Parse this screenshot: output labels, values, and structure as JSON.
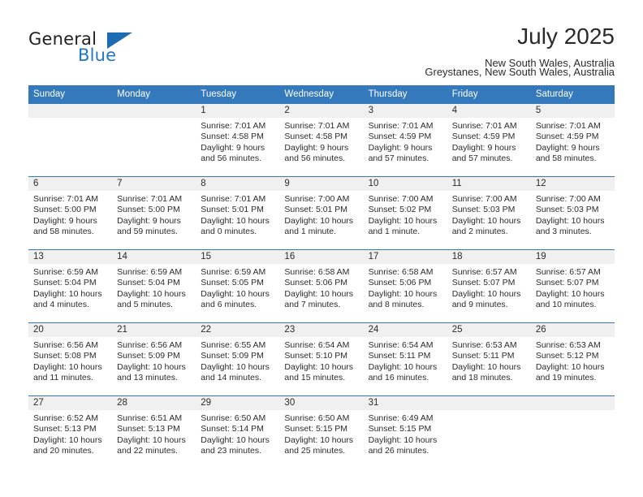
{
  "brand": {
    "name_part1": "General",
    "name_part2": "Blue",
    "triangle_color": "#1b6cb3",
    "blue_color": "#1f78c1"
  },
  "header": {
    "month_title": "July 2025",
    "region_line": "New South Wales, Australia",
    "location_line": "Greystanes, New South Wales, Australia"
  },
  "theme": {
    "header_bg": "#3479bb",
    "daynum_bg": "#f0f0f0",
    "text": "#2b2b2b"
  },
  "calendar": {
    "weekday_headers": [
      "Sunday",
      "Monday",
      "Tuesday",
      "Wednesday",
      "Thursday",
      "Friday",
      "Saturday"
    ],
    "weeks": [
      [
        {
          "day": "",
          "empty": true,
          "sunrise": "",
          "sunset": "",
          "daylight_line1": "",
          "daylight_line2": ""
        },
        {
          "day": "",
          "empty": true,
          "sunrise": "",
          "sunset": "",
          "daylight_line1": "",
          "daylight_line2": ""
        },
        {
          "day": "1",
          "sunrise": "Sunrise: 7:01 AM",
          "sunset": "Sunset: 4:58 PM",
          "daylight_line1": "Daylight: 9 hours",
          "daylight_line2": "and 56 minutes."
        },
        {
          "day": "2",
          "sunrise": "Sunrise: 7:01 AM",
          "sunset": "Sunset: 4:58 PM",
          "daylight_line1": "Daylight: 9 hours",
          "daylight_line2": "and 56 minutes."
        },
        {
          "day": "3",
          "sunrise": "Sunrise: 7:01 AM",
          "sunset": "Sunset: 4:59 PM",
          "daylight_line1": "Daylight: 9 hours",
          "daylight_line2": "and 57 minutes."
        },
        {
          "day": "4",
          "sunrise": "Sunrise: 7:01 AM",
          "sunset": "Sunset: 4:59 PM",
          "daylight_line1": "Daylight: 9 hours",
          "daylight_line2": "and 57 minutes."
        },
        {
          "day": "5",
          "sunrise": "Sunrise: 7:01 AM",
          "sunset": "Sunset: 4:59 PM",
          "daylight_line1": "Daylight: 9 hours",
          "daylight_line2": "and 58 minutes."
        }
      ],
      [
        {
          "day": "6",
          "sunrise": "Sunrise: 7:01 AM",
          "sunset": "Sunset: 5:00 PM",
          "daylight_line1": "Daylight: 9 hours",
          "daylight_line2": "and 58 minutes."
        },
        {
          "day": "7",
          "sunrise": "Sunrise: 7:01 AM",
          "sunset": "Sunset: 5:00 PM",
          "daylight_line1": "Daylight: 9 hours",
          "daylight_line2": "and 59 minutes."
        },
        {
          "day": "8",
          "sunrise": "Sunrise: 7:01 AM",
          "sunset": "Sunset: 5:01 PM",
          "daylight_line1": "Daylight: 10 hours",
          "daylight_line2": "and 0 minutes."
        },
        {
          "day": "9",
          "sunrise": "Sunrise: 7:00 AM",
          "sunset": "Sunset: 5:01 PM",
          "daylight_line1": "Daylight: 10 hours",
          "daylight_line2": "and 1 minute."
        },
        {
          "day": "10",
          "sunrise": "Sunrise: 7:00 AM",
          "sunset": "Sunset: 5:02 PM",
          "daylight_line1": "Daylight: 10 hours",
          "daylight_line2": "and 1 minute."
        },
        {
          "day": "11",
          "sunrise": "Sunrise: 7:00 AM",
          "sunset": "Sunset: 5:03 PM",
          "daylight_line1": "Daylight: 10 hours",
          "daylight_line2": "and 2 minutes."
        },
        {
          "day": "12",
          "sunrise": "Sunrise: 7:00 AM",
          "sunset": "Sunset: 5:03 PM",
          "daylight_line1": "Daylight: 10 hours",
          "daylight_line2": "and 3 minutes."
        }
      ],
      [
        {
          "day": "13",
          "sunrise": "Sunrise: 6:59 AM",
          "sunset": "Sunset: 5:04 PM",
          "daylight_line1": "Daylight: 10 hours",
          "daylight_line2": "and 4 minutes."
        },
        {
          "day": "14",
          "sunrise": "Sunrise: 6:59 AM",
          "sunset": "Sunset: 5:04 PM",
          "daylight_line1": "Daylight: 10 hours",
          "daylight_line2": "and 5 minutes."
        },
        {
          "day": "15",
          "sunrise": "Sunrise: 6:59 AM",
          "sunset": "Sunset: 5:05 PM",
          "daylight_line1": "Daylight: 10 hours",
          "daylight_line2": "and 6 minutes."
        },
        {
          "day": "16",
          "sunrise": "Sunrise: 6:58 AM",
          "sunset": "Sunset: 5:06 PM",
          "daylight_line1": "Daylight: 10 hours",
          "daylight_line2": "and 7 minutes."
        },
        {
          "day": "17",
          "sunrise": "Sunrise: 6:58 AM",
          "sunset": "Sunset: 5:06 PM",
          "daylight_line1": "Daylight: 10 hours",
          "daylight_line2": "and 8 minutes."
        },
        {
          "day": "18",
          "sunrise": "Sunrise: 6:57 AM",
          "sunset": "Sunset: 5:07 PM",
          "daylight_line1": "Daylight: 10 hours",
          "daylight_line2": "and 9 minutes."
        },
        {
          "day": "19",
          "sunrise": "Sunrise: 6:57 AM",
          "sunset": "Sunset: 5:07 PM",
          "daylight_line1": "Daylight: 10 hours",
          "daylight_line2": "and 10 minutes."
        }
      ],
      [
        {
          "day": "20",
          "sunrise": "Sunrise: 6:56 AM",
          "sunset": "Sunset: 5:08 PM",
          "daylight_line1": "Daylight: 10 hours",
          "daylight_line2": "and 11 minutes."
        },
        {
          "day": "21",
          "sunrise": "Sunrise: 6:56 AM",
          "sunset": "Sunset: 5:09 PM",
          "daylight_line1": "Daylight: 10 hours",
          "daylight_line2": "and 13 minutes."
        },
        {
          "day": "22",
          "sunrise": "Sunrise: 6:55 AM",
          "sunset": "Sunset: 5:09 PM",
          "daylight_line1": "Daylight: 10 hours",
          "daylight_line2": "and 14 minutes."
        },
        {
          "day": "23",
          "sunrise": "Sunrise: 6:54 AM",
          "sunset": "Sunset: 5:10 PM",
          "daylight_line1": "Daylight: 10 hours",
          "daylight_line2": "and 15 minutes."
        },
        {
          "day": "24",
          "sunrise": "Sunrise: 6:54 AM",
          "sunset": "Sunset: 5:11 PM",
          "daylight_line1": "Daylight: 10 hours",
          "daylight_line2": "and 16 minutes."
        },
        {
          "day": "25",
          "sunrise": "Sunrise: 6:53 AM",
          "sunset": "Sunset: 5:11 PM",
          "daylight_line1": "Daylight: 10 hours",
          "daylight_line2": "and 18 minutes."
        },
        {
          "day": "26",
          "sunrise": "Sunrise: 6:53 AM",
          "sunset": "Sunset: 5:12 PM",
          "daylight_line1": "Daylight: 10 hours",
          "daylight_line2": "and 19 minutes."
        }
      ],
      [
        {
          "day": "27",
          "sunrise": "Sunrise: 6:52 AM",
          "sunset": "Sunset: 5:13 PM",
          "daylight_line1": "Daylight: 10 hours",
          "daylight_line2": "and 20 minutes."
        },
        {
          "day": "28",
          "sunrise": "Sunrise: 6:51 AM",
          "sunset": "Sunset: 5:13 PM",
          "daylight_line1": "Daylight: 10 hours",
          "daylight_line2": "and 22 minutes."
        },
        {
          "day": "29",
          "sunrise": "Sunrise: 6:50 AM",
          "sunset": "Sunset: 5:14 PM",
          "daylight_line1": "Daylight: 10 hours",
          "daylight_line2": "and 23 minutes."
        },
        {
          "day": "30",
          "sunrise": "Sunrise: 6:50 AM",
          "sunset": "Sunset: 5:15 PM",
          "daylight_line1": "Daylight: 10 hours",
          "daylight_line2": "and 25 minutes."
        },
        {
          "day": "31",
          "sunrise": "Sunrise: 6:49 AM",
          "sunset": "Sunset: 5:15 PM",
          "daylight_line1": "Daylight: 10 hours",
          "daylight_line2": "and 26 minutes."
        },
        {
          "day": "",
          "empty": true,
          "sunrise": "",
          "sunset": "",
          "daylight_line1": "",
          "daylight_line2": ""
        },
        {
          "day": "",
          "empty": true,
          "sunrise": "",
          "sunset": "",
          "daylight_line1": "",
          "daylight_line2": ""
        }
      ]
    ]
  }
}
